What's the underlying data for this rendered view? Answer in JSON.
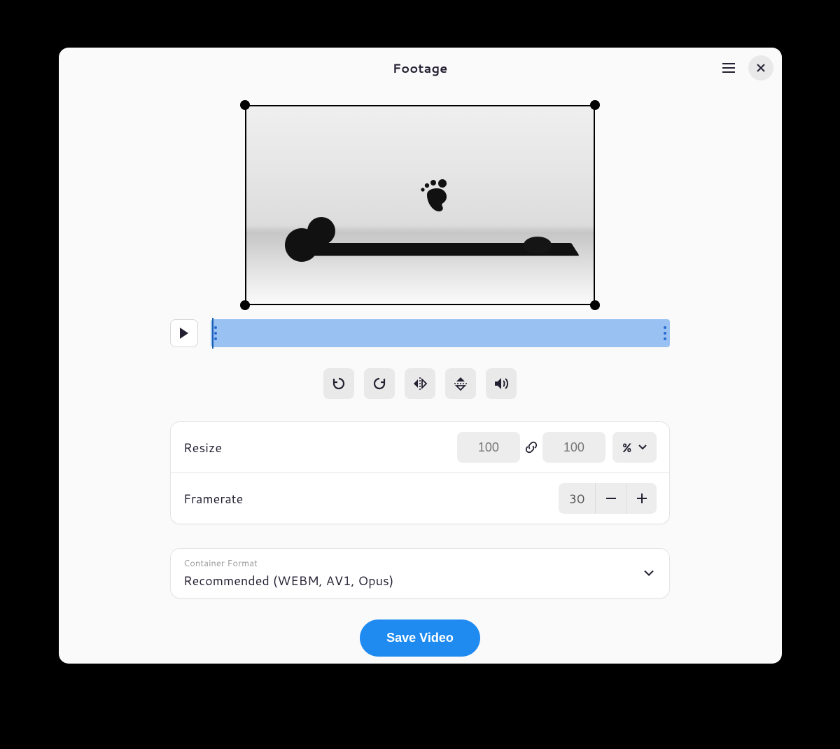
{
  "window": {
    "title": "Footage"
  },
  "resize": {
    "label": "Resize",
    "width": "100",
    "height": "100",
    "unit": "%"
  },
  "framerate": {
    "label": "Framerate",
    "value": "30"
  },
  "container_format": {
    "label": "Container Format",
    "value": "Recommended (WEBM, AV1, Opus)"
  },
  "actions": {
    "save": "Save Video"
  }
}
